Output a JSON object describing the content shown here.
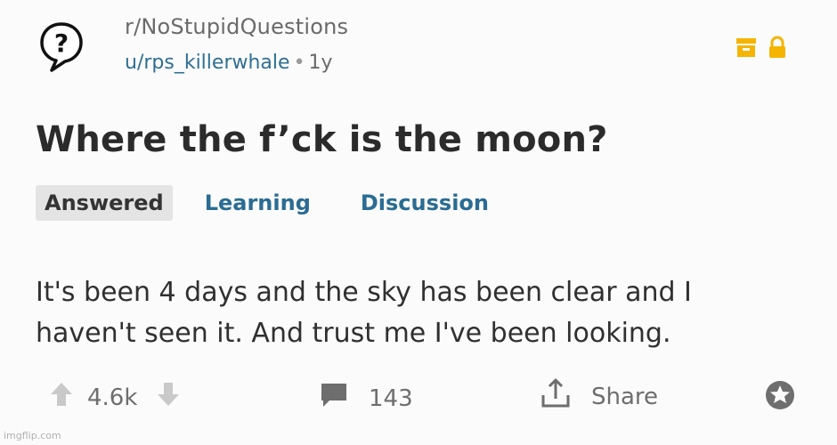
{
  "post": {
    "subreddit": "r/NoStupidQuestions",
    "author": "u/rps_killerwhale",
    "separator": "•",
    "age": "1y",
    "title": "Where the f’ck is the moon?",
    "flairs": [
      "Answered",
      "Learning",
      "Discussion"
    ],
    "body_line1": "It's been 4 days and the sky has been clear and I",
    "body_line2": "haven't seen it. And trust me I've been looking."
  },
  "actions": {
    "score": "4.6k",
    "comments": "143",
    "share_label": "Share"
  },
  "icons": {
    "subreddit": "question-bubble-icon",
    "archive": "archive-box-icon",
    "lock": "lock-icon",
    "upvote": "upvote-arrow-icon",
    "downvote": "downvote-arrow-icon",
    "comment": "comment-bubble-icon",
    "share": "share-icon",
    "award": "award-icon"
  },
  "colors": {
    "link": "#2f6f93",
    "flair_text": "#2a6c93",
    "mod_yellow": "#f5b400",
    "muted": "#6e6e6e"
  },
  "watermark": "imgflip.com"
}
